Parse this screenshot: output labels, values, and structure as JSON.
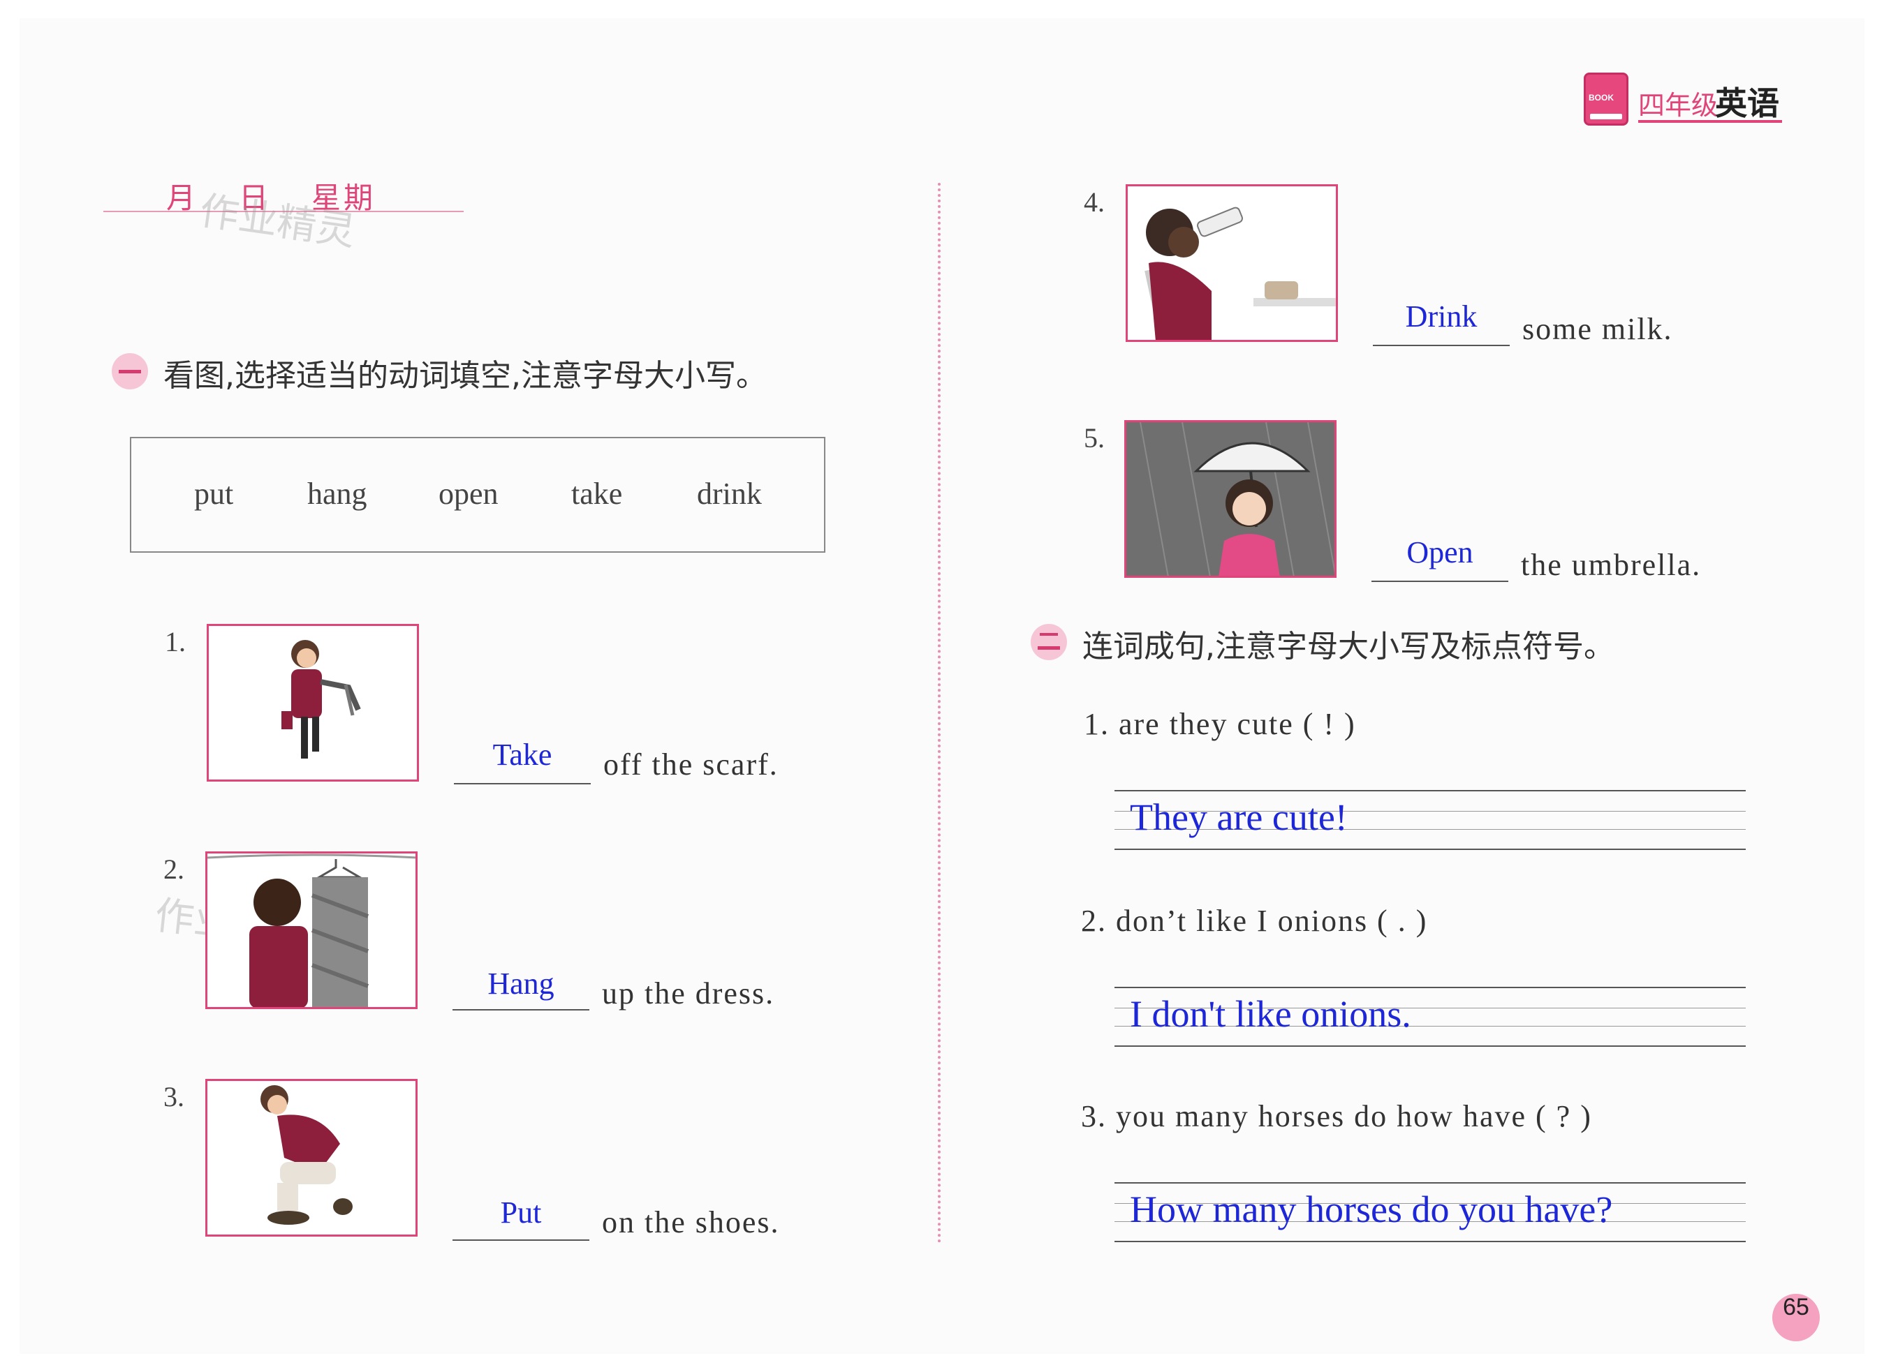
{
  "header": {
    "book_icon_label": "BOOK",
    "grade": "四年级",
    "subject": "英语"
  },
  "date_line": {
    "month": "月",
    "day": "日",
    "weekday": "星期"
  },
  "watermark": "作业精灵",
  "section1": {
    "badge": "一",
    "instruction": "看图,选择适当的动词填空,注意字母大小写。",
    "word_bank": [
      "put",
      "hang",
      "open",
      "take",
      "drink"
    ],
    "items": [
      {
        "number": "1.",
        "answer": "Take",
        "rest": "off  the  scarf.",
        "picture": "girl-holding-scarf"
      },
      {
        "number": "2.",
        "answer": "Hang",
        "rest": "up  the  dress.",
        "picture": "girl-hanging-dress"
      },
      {
        "number": "3.",
        "answer": "Put",
        "rest": "on  the  shoes.",
        "picture": "boy-putting-on-shoes"
      },
      {
        "number": "4.",
        "answer": "Drink",
        "rest": "some  milk.",
        "picture": "boy-drinking-milk"
      },
      {
        "number": "5.",
        "answer": "Open",
        "rest": "the  umbrella.",
        "picture": "girl-with-umbrella"
      }
    ]
  },
  "section2": {
    "badge": "二",
    "instruction": "连词成句,注意字母大小写及标点符号。",
    "items": [
      {
        "prompt": "1. are     they    cute ( ! )",
        "answer": "They are cute!"
      },
      {
        "prompt": "2. don’t     like     I     onions ( . )",
        "answer": "I don't like onions."
      },
      {
        "prompt": "3. you     many     horses     do     how     have ( ? )",
        "answer": "How many horses do you have?"
      }
    ]
  },
  "page_number": "65"
}
